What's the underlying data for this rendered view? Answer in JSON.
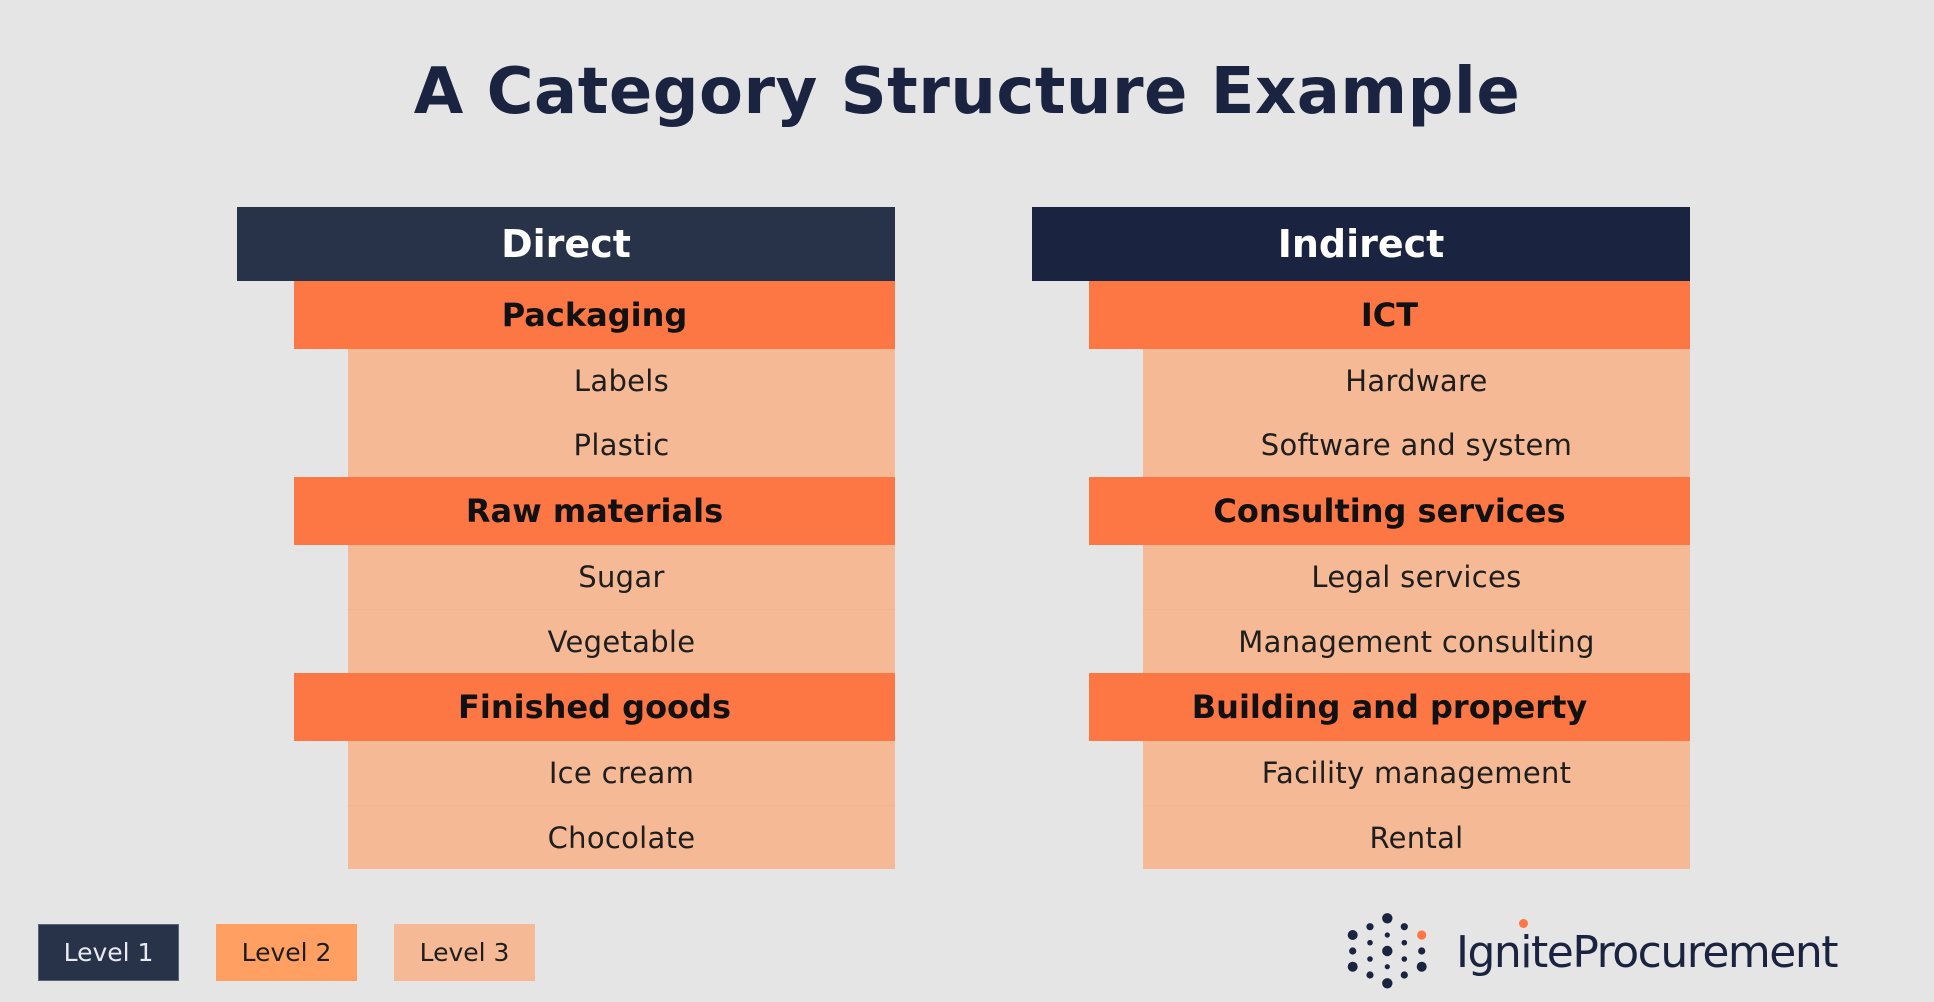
{
  "title": "A Category Structure Example",
  "colors": {
    "background": "#E5E5E5",
    "level1_direct": "#283349",
    "level1_indirect": "#1A2340",
    "level2": "#FD7744",
    "level2_legend": "#FFA062",
    "level3": "#F5BA95",
    "brand_accent": "#FD7744",
    "brand_dark": "#1A2340"
  },
  "columns": [
    {
      "level1": "Direct",
      "groups": [
        {
          "level2": "Packaging",
          "level3": [
            "Labels",
            "Plastic"
          ]
        },
        {
          "level2": "Raw materials",
          "level3": [
            "Sugar",
            "Vegetable"
          ]
        },
        {
          "level2": "Finished goods",
          "level3": [
            "Ice cream",
            "Chocolate"
          ]
        }
      ]
    },
    {
      "level1": "Indirect",
      "groups": [
        {
          "level2": "ICT",
          "level3": [
            "Hardware",
            "Software and system"
          ]
        },
        {
          "level2": "Consulting services",
          "level3": [
            "Legal services",
            "Management consulting"
          ]
        },
        {
          "level2": "Building and property",
          "level3": [
            "Facility management",
            "Rental"
          ]
        }
      ]
    }
  ],
  "legend": [
    {
      "label": "Level 1"
    },
    {
      "label": "Level 2"
    },
    {
      "label": "Level 3"
    }
  ],
  "logo": {
    "icon": "dot-grid-icon",
    "text": "IgniteProcurement"
  }
}
